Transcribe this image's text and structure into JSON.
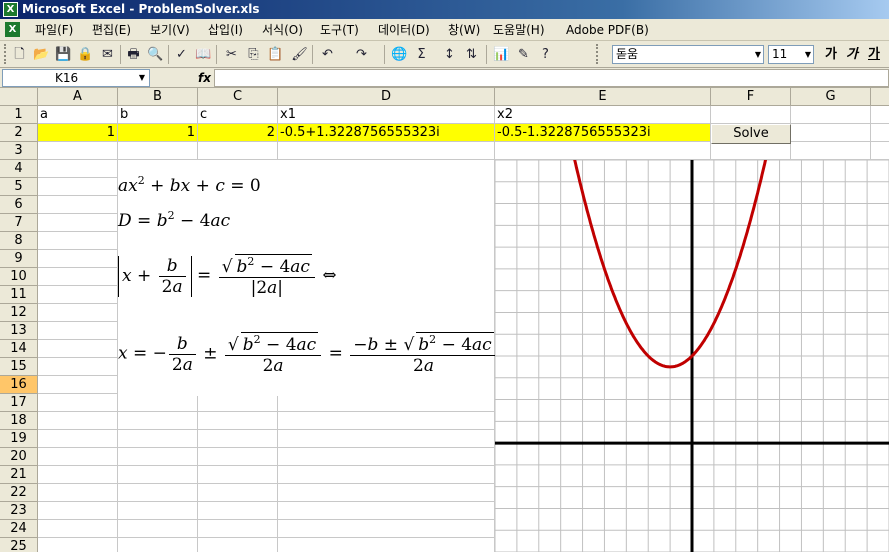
{
  "window": {
    "title": "Microsoft Excel - ProblemSolver.xls",
    "app_icon": "X"
  },
  "menu": [
    {
      "label": "파일(F)"
    },
    {
      "label": "편집(E)"
    },
    {
      "label": "보기(V)"
    },
    {
      "label": "삽입(I)"
    },
    {
      "label": "서식(O)"
    },
    {
      "label": "도구(T)"
    },
    {
      "label": "데이터(D)"
    },
    {
      "label": "창(W)"
    },
    {
      "label": "도움말(H)"
    },
    {
      "label": "Adobe PDF(B)"
    }
  ],
  "toolbar": {
    "font": "돋움",
    "font_size": "11",
    "bold": "가",
    "italic": "가",
    "underline": "가"
  },
  "formula_bar": {
    "name_box": "K16",
    "fx": "fx",
    "formula": ""
  },
  "columns": [
    "A",
    "B",
    "C",
    "D",
    "E",
    "F",
    "G"
  ],
  "rows": [
    "1",
    "2",
    "3",
    "4",
    "5",
    "6",
    "7",
    "8",
    "9",
    "10",
    "11",
    "12",
    "13",
    "14",
    "15",
    "16",
    "17",
    "18",
    "19",
    "20",
    "21",
    "22",
    "23",
    "24",
    "25"
  ],
  "cells": {
    "A1": "a",
    "B1": "b",
    "C1": "c",
    "D1": "x1",
    "E1": "x2",
    "A2": "1",
    "B2": "1",
    "C2": "2",
    "D2": "-0.5+1.3228756555323i",
    "E2": "-0.5-1.3228756555323i"
  },
  "solve_button": {
    "label": "Solve"
  },
  "selected_row": "16",
  "colors": {
    "highlight": "#ffff00",
    "curve": "#c00000",
    "selected_header": "#ffc669"
  },
  "chart_data": {
    "type": "line",
    "title": "",
    "xlabel": "",
    "ylabel": "",
    "grid": true,
    "xlim": [
      -4.5,
      4.5
    ],
    "ylim": [
      -2.5,
      6.5
    ],
    "series": [
      {
        "name": "",
        "function": "y = x^2 + x + 2",
        "vertex": [
          -0.5,
          1.75
        ]
      }
    ]
  }
}
